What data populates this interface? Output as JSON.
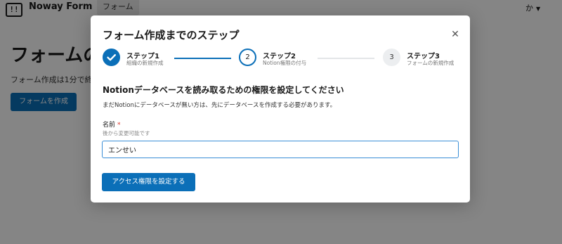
{
  "app": {
    "brand": "Noway Form",
    "nav_tab": "フォーム",
    "user_label": "か"
  },
  "background_page": {
    "title": "フォームの",
    "description": "フォーム作成は1分で終",
    "create_button": "フォームを作成"
  },
  "modal": {
    "title": "フォーム作成までのステップ",
    "steps": [
      {
        "number": "1",
        "name": "ステップ1",
        "sub": "組織の新規作成",
        "state": "done"
      },
      {
        "number": "2",
        "name": "ステップ2",
        "sub": "Notion権限の付与",
        "state": "active"
      },
      {
        "number": "3",
        "name": "ステップ3",
        "sub": "フォームの新規作成",
        "state": "todo"
      }
    ],
    "section_title": "Notionデータベースを読み取るための権限を設定してください",
    "section_desc": "まだNotionにデータベースが無い方は、先にデータベースを作成する必要があります。",
    "field": {
      "label": "名前",
      "required_mark": "*",
      "hint": "後から変更可能です",
      "value": "エンせい"
    },
    "submit_button": "アクセス権限を設定する"
  },
  "colors": {
    "accent": "#0b6fb8",
    "overlay": "rgba(0,0,0,0.48)"
  }
}
